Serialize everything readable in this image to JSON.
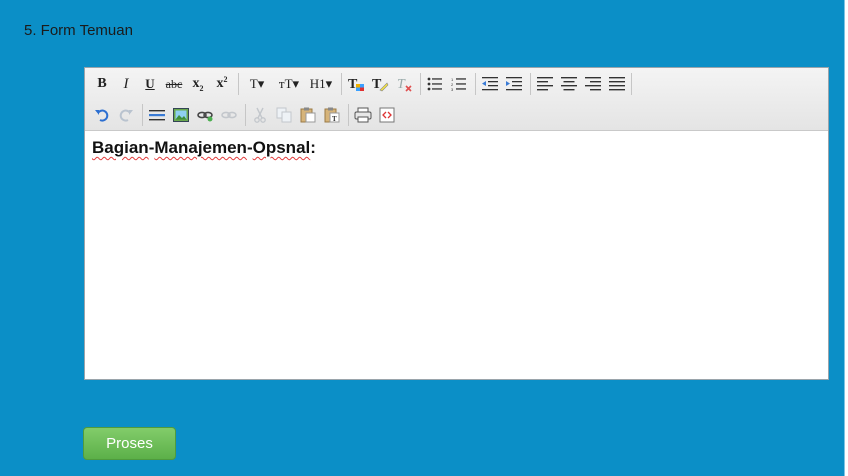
{
  "form": {
    "section_title": "5. Form Temuan",
    "submit_label": "Proses"
  },
  "editor": {
    "toolbar_row1": [
      {
        "name": "bold-button",
        "glyph": "B"
      },
      {
        "name": "italic-button",
        "glyph": "I"
      },
      {
        "name": "underline-button",
        "glyph": "U"
      },
      {
        "name": "strikethrough-button",
        "glyph": "abc"
      },
      {
        "name": "subscript-button",
        "glyph": "x₂"
      },
      {
        "name": "superscript-button",
        "glyph": "x²"
      },
      {
        "name": "font-family-dropdown",
        "glyph": "T▾"
      },
      {
        "name": "font-size-dropdown",
        "glyph": "тT▾"
      },
      {
        "name": "heading-dropdown",
        "glyph": "H1▾"
      },
      {
        "name": "text-color-button",
        "glyph": "T"
      },
      {
        "name": "highlight-color-button",
        "glyph": "T"
      },
      {
        "name": "remove-format-button",
        "glyph": "T"
      },
      {
        "name": "bulleted-list-button",
        "glyph": "☰"
      },
      {
        "name": "numbered-list-button",
        "glyph": "☰"
      },
      {
        "name": "outdent-button",
        "glyph": "⇤"
      },
      {
        "name": "indent-button",
        "glyph": "⇥"
      },
      {
        "name": "align-left-button",
        "glyph": "≡"
      },
      {
        "name": "align-center-button",
        "glyph": "≡"
      },
      {
        "name": "align-right-button",
        "glyph": "≡"
      },
      {
        "name": "justify-button",
        "glyph": "≡"
      }
    ],
    "toolbar_row2": [
      {
        "name": "undo-button",
        "glyph": "↶"
      },
      {
        "name": "redo-button",
        "glyph": "↷"
      },
      {
        "name": "horizontal-rule-button",
        "glyph": "—"
      },
      {
        "name": "insert-image-button",
        "glyph": "▣"
      },
      {
        "name": "insert-link-button",
        "glyph": "🔗"
      },
      {
        "name": "unlink-button",
        "glyph": "⛓"
      },
      {
        "name": "cut-button",
        "glyph": "✂"
      },
      {
        "name": "copy-button",
        "glyph": "⧉"
      },
      {
        "name": "paste-button",
        "glyph": "📋"
      },
      {
        "name": "paste-text-button",
        "glyph": "📋"
      },
      {
        "name": "print-button",
        "glyph": "⎙"
      },
      {
        "name": "source-code-button",
        "glyph": "‹›"
      }
    ],
    "content": {
      "word1": "Bagian",
      "word2": "Manajemen",
      "word3": "Opsnal",
      "suffix": ":"
    }
  },
  "colors": {
    "panel_background": "#0b8fc7",
    "submit_button": "#6dbf57",
    "spellcheck_underline": "#e23b3b"
  }
}
